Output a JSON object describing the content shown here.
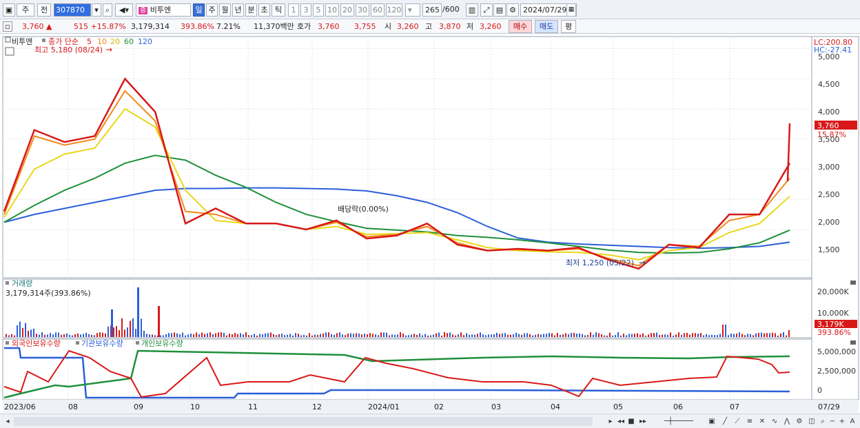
{
  "toolbar": {
    "type_btn": "주",
    "prev_btn": "전",
    "code": "307870",
    "stock_name": "비투엔",
    "periods": [
      "일",
      "주",
      "월",
      "년",
      "분",
      "초",
      "틱"
    ],
    "active_period": "일",
    "intervals": [
      "1",
      "3",
      "5",
      "10",
      "20",
      "30",
      "60",
      "120"
    ],
    "count": "265",
    "count_total": "/600",
    "date": "2024/07/29"
  },
  "quote": {
    "price": "3,760",
    "change": "515",
    "change_pct": "+15.87%",
    "volume": "3,179,314",
    "volume_ratio": "393.86%",
    "turnover": "7.21%",
    "amount": "11,370백만",
    "ask_label": "호가",
    "ask1": "3,760",
    "ask2": "3,755",
    "open_label": "시",
    "open": "3,260",
    "high_label": "고",
    "high": "3,870",
    "low_label": "저",
    "low": "3,260",
    "buy_label": "매수",
    "sell_label": "매도",
    "eval_label": "평"
  },
  "price_panel": {
    "stock_tag": "비투엔",
    "ma_legend_prefix": "종가 단순",
    "ma_legend": [
      {
        "period": "5",
        "color": "#d81818"
      },
      {
        "period": "10",
        "color": "#f08a1a"
      },
      {
        "period": "20",
        "color": "#e8d81a"
      },
      {
        "period": "60",
        "color": "#1f8f3a"
      },
      {
        "period": "120",
        "color": "#2a5fd8"
      }
    ],
    "max_label": "최고 5,180 (08/24)",
    "min_label": "최저 1,250 (05/22)",
    "dividend_label": "배당락(0.00%)",
    "lc": "LC:200.80",
    "hc": "HC:-27.41",
    "last_price_tag": "3,760",
    "last_pct_tag": "15.87%",
    "y_ticks": [
      "5,000",
      "4,500",
      "4,000",
      "3,500",
      "3,000",
      "2,500",
      "2,000",
      "1,500"
    ]
  },
  "volume_panel": {
    "title": "거래량",
    "value_label": "3,179,314주(393.86%)",
    "y_ticks": [
      "20,000K",
      "10,000K"
    ],
    "last_tag": "3,179K",
    "last_pct": "393.86%"
  },
  "holdings_panel": {
    "legend": [
      "외국인보유수량",
      "기관보유수량",
      "개인보유수량"
    ],
    "y_ticks": [
      "5,000,000",
      "2,500,000",
      "0"
    ]
  },
  "x_axis": [
    "2023/06",
    "08",
    "09",
    "10",
    "11",
    "12",
    "2024/01",
    "02",
    "03",
    "04",
    "05",
    "06",
    "07"
  ],
  "x_axis_right": "07/29",
  "chart_data": {
    "type": "line",
    "title": "비투엔",
    "x_axis_labels": [
      "2023/06",
      "08",
      "09",
      "10",
      "11",
      "12",
      "2024/01",
      "02",
      "03",
      "04",
      "05",
      "06",
      "07"
    ],
    "price_range": [
      1200,
      5200
    ],
    "series": [
      {
        "name": "5",
        "color": "#d81818",
        "values": [
          2300,
          3650,
          3450,
          3550,
          4500,
          3950,
          2100,
          2350,
          2100,
          2100,
          2000,
          2150,
          1850,
          1900,
          2100,
          1750,
          1650,
          1680,
          1650,
          1700,
          1500,
          1350,
          1750,
          1700,
          2250,
          2250,
          3100
        ]
      },
      {
        "name": "10",
        "color": "#f08a1a",
        "values": [
          2250,
          3550,
          3400,
          3500,
          4300,
          3800,
          2300,
          2250,
          2100,
          2100,
          2000,
          2120,
          1880,
          1920,
          2050,
          1780,
          1650,
          1670,
          1650,
          1680,
          1520,
          1400,
          1750,
          1720,
          2150,
          2250,
          2850
        ]
      },
      {
        "name": "20",
        "color": "#e8d81a",
        "values": [
          2200,
          3000,
          3250,
          3350,
          4000,
          3700,
          2650,
          2150,
          2100,
          2100,
          2000,
          2050,
          1920,
          1930,
          1950,
          1830,
          1700,
          1650,
          1630,
          1620,
          1580,
          1500,
          1650,
          1700,
          1950,
          2100,
          2550
        ]
      },
      {
        "name": "60",
        "color": "#1f8f3a",
        "values": [
          2120,
          2400,
          2650,
          2850,
          3100,
          3230,
          3150,
          2900,
          2700,
          2450,
          2250,
          2130,
          2020,
          1990,
          1960,
          1900,
          1870,
          1830,
          1780,
          1720,
          1660,
          1620,
          1610,
          1620,
          1680,
          1780,
          1990
        ]
      },
      {
        "name": "120",
        "color": "#2a5fd8",
        "values": [
          2120,
          2250,
          2350,
          2450,
          2550,
          2650,
          2680,
          2680,
          2690,
          2690,
          2680,
          2670,
          2640,
          2560,
          2450,
          2280,
          2050,
          1860,
          1790,
          1760,
          1740,
          1720,
          1700,
          1690,
          1700,
          1720,
          1790
        ]
      }
    ]
  }
}
